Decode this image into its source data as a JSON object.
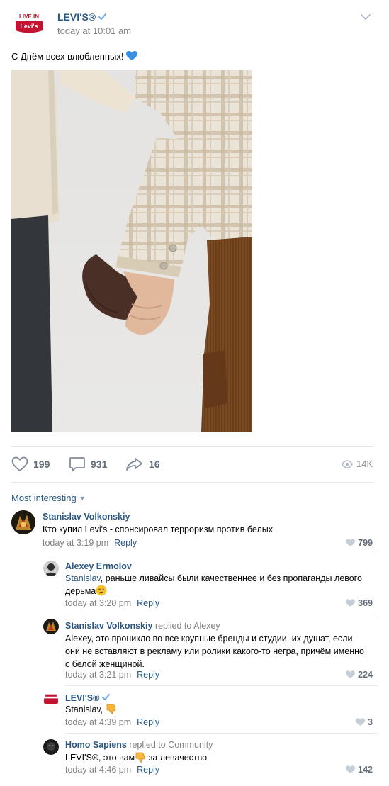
{
  "post": {
    "brand_name": "LEVI'S®",
    "logo_text_top": "LIVE IN",
    "logo_text_bottom": "Levi's",
    "time": "today at 10:01 am",
    "text": "С Днём всех влюбленных!",
    "emoji": "blue-heart-icon"
  },
  "actions": {
    "likes": "199",
    "comments": "931",
    "shares": "16",
    "views": "14K"
  },
  "sort_label": "Most interesting",
  "comments": [
    {
      "author": "Stanislav Volkonskiy",
      "replied": "",
      "text": "Кто купил Levi's - спонсировал терроризм против белых",
      "time": "today at 3:19 pm",
      "reply_label": "Reply",
      "likes": "799"
    },
    {
      "author": "Alexey Ermolov",
      "replied": "",
      "mention": "Stanislav",
      "text": ", раньше ливайсы были качественнее и без пропаганды левого дерьма",
      "time": "today at 3:20 pm",
      "reply_label": "Reply",
      "likes": "369"
    },
    {
      "author": "Stanislav Volkonskiy",
      "replied": "replied to Alexey",
      "text": "Alexey, это проникло во все крупные бренды и студии, их душат, если они не вставляют в рекламу или ролики какого-то негра, причём именно с белой женщиной.",
      "time": "today at 3:21 pm",
      "reply_label": "Reply",
      "likes": "224"
    },
    {
      "author": "LEVI'S®",
      "replied": "",
      "text": "Stanislav,",
      "time": "today at 4:39 pm",
      "reply_label": "Reply",
      "likes": "3"
    },
    {
      "author": "Homo Sapiens",
      "replied": "replied to Community",
      "text_before": "LEVI'S®, это вам",
      "text_after": " за левачество",
      "time": "today at 4:46 pm",
      "reply_label": "Reply",
      "likes": "142"
    }
  ],
  "colors": {
    "link": "#2a5885",
    "meta": "#828282",
    "levis_red": "#c41230",
    "divider": "#e7e8ec"
  }
}
